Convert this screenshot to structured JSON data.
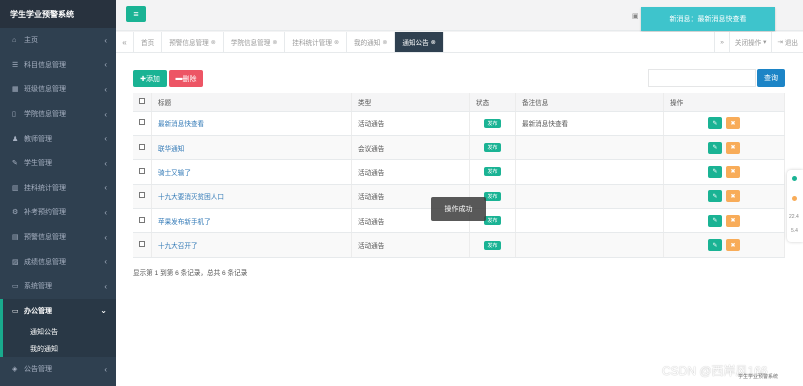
{
  "app": {
    "title": "学生学业预警系统"
  },
  "sidebar": {
    "items": [
      {
        "icon": "home-icon",
        "glyph": "⌂",
        "label": "主页"
      },
      {
        "icon": "list-icon",
        "glyph": "☰",
        "label": "科目信息管理"
      },
      {
        "icon": "calendar-icon",
        "glyph": "▦",
        "label": "班级信息管理"
      },
      {
        "icon": "file-icon",
        "glyph": "▯",
        "label": "学院信息管理"
      },
      {
        "icon": "teacher-icon",
        "glyph": "♟",
        "label": "教师管理"
      },
      {
        "icon": "student-icon",
        "glyph": "✎",
        "label": "学生管理"
      },
      {
        "icon": "stats-icon",
        "glyph": "▥",
        "label": "挂科统计管理"
      },
      {
        "icon": "exam-icon",
        "glyph": "⚙",
        "label": "补考预约管理"
      },
      {
        "icon": "warning-icon",
        "glyph": "▤",
        "label": "预警信息管理"
      },
      {
        "icon": "chart-icon",
        "glyph": "▨",
        "label": "成绩信息管理"
      },
      {
        "icon": "monitor-icon",
        "glyph": "▭",
        "label": "系统管理"
      }
    ],
    "active": {
      "icon": "laptop-icon",
      "glyph": "▭",
      "label": "办公管理",
      "children": [
        "通知公告",
        "我的通知"
      ]
    },
    "bottom": {
      "icon": "announcement-icon",
      "glyph": "◈",
      "label": "公告管理"
    }
  },
  "header": {
    "toast": "新消息：最新消息快查看"
  },
  "tabs": {
    "items": [
      {
        "label": "首页",
        "closable": false
      },
      {
        "label": "预警信息管理",
        "closable": true
      },
      {
        "label": "学院信息管理",
        "closable": true
      },
      {
        "label": "挂科统计管理",
        "closable": true
      },
      {
        "label": "我的通知",
        "closable": true
      },
      {
        "label": "通知公告",
        "closable": true,
        "active": true
      }
    ],
    "close_ops": "关闭操作",
    "logout": "退出"
  },
  "toolbar": {
    "add_label": "添加",
    "delete_label": "删除",
    "search_placeholder": "",
    "search_label": "查询"
  },
  "table": {
    "headers": [
      "标题",
      "类型",
      "状态",
      "备注信息",
      "操作"
    ],
    "rows": [
      {
        "title": "最新消息快查看",
        "type": "活动通告",
        "status": "发布",
        "remark": "最新消息快查看"
      },
      {
        "title": "联华通知",
        "type": "会议通告",
        "status": "发布",
        "remark": ""
      },
      {
        "title": "骑士又输了",
        "type": "活动通告",
        "status": "发布",
        "remark": ""
      },
      {
        "title": "十九大要消灭贫困人口",
        "type": "活动通告",
        "status": "发布",
        "remark": ""
      },
      {
        "title": "苹果发布新手机了",
        "type": "活动通告",
        "status": "发布",
        "remark": ""
      },
      {
        "title": "十九大召开了",
        "type": "活动通告",
        "status": "发布",
        "remark": ""
      }
    ]
  },
  "pager": {
    "info": "显示第 1 到第 6 条记录，总共 6 条记录"
  },
  "popup": {
    "message": "操作成功"
  },
  "mini_widget": {
    "v1": "22.4",
    "v2": "5.4"
  },
  "watermark": {
    "main": "CSDN @西岸风166",
    "small": "学生学业预警系统"
  },
  "colors": {
    "primary": "#1ab394",
    "danger": "#ed5565",
    "warning": "#f8ac59",
    "info": "#1c84c6",
    "sidebar": "#2f4050"
  }
}
